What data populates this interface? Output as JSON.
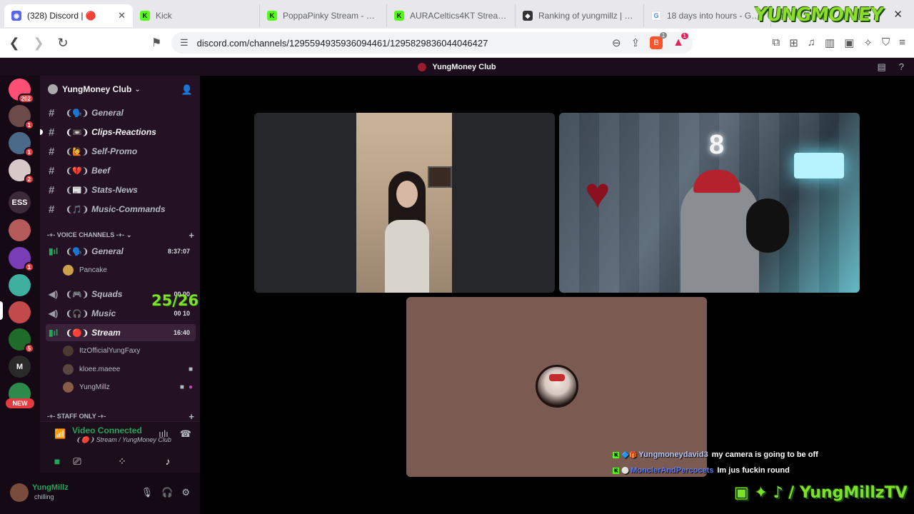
{
  "browser": {
    "tabs": [
      {
        "label": "(328) Discord | 🔴",
        "icon": "discord-icon",
        "active": true
      },
      {
        "label": "Kick",
        "icon": "kick-icon"
      },
      {
        "label": "PoppaPinky Stream - Watc",
        "icon": "kick-icon"
      },
      {
        "label": "AURACeltics4KT Stream - V",
        "icon": "kick-icon"
      },
      {
        "label": "Ranking of yungmillz | Bot",
        "icon": "shield-icon"
      },
      {
        "label": "18 days into hours - Goog",
        "icon": "google-icon"
      }
    ],
    "new_tab": "+",
    "url": "discord.com/channels/1295594935936094461/1295829836044046427",
    "brave_shield_count": "1",
    "rewards_count": "1"
  },
  "watermark": "YUNGMONEY",
  "discord": {
    "top_title": "YungMoney Club",
    "guilds": [
      {
        "label": "",
        "badge": "202",
        "color": "#ff4f75"
      },
      {
        "label": "",
        "badge": "1",
        "color": "#6b4a4a"
      },
      {
        "label": "",
        "badge": "1",
        "color": "#4b6a8a"
      },
      {
        "label": "",
        "badge": "2",
        "color": "#d8c9c9"
      },
      {
        "label": "ESS",
        "badge": "",
        "color": "#3c2a3a"
      },
      {
        "label": "",
        "badge": "",
        "color": "#b55a5a"
      },
      {
        "label": "",
        "badge": "1",
        "color": "#7a3db8"
      },
      {
        "label": "",
        "badge": "",
        "color": "#3fb0a0"
      },
      {
        "label": "",
        "badge": "",
        "color": "#c24a4a"
      },
      {
        "label": "",
        "badge": "5",
        "color": "#1e6b2a"
      },
      {
        "label": "M",
        "badge": "",
        "color": "#2a2a2a"
      },
      {
        "label": "",
        "badge": "",
        "color": "#2e8a4a"
      },
      {
        "label": "NEW",
        "badge": "",
        "color": "#e23b40"
      }
    ],
    "server_name": "YungMoney Club",
    "text_channels": [
      {
        "name": "General",
        "emoji": "❨🗣️❩",
        "unread": false
      },
      {
        "name": "Clips-Reactions",
        "emoji": "❨📼❩",
        "unread": true
      },
      {
        "name": "Self-Promo",
        "emoji": "❨🙋❩",
        "unread": false
      },
      {
        "name": "Beef",
        "emoji": "❨💔❩",
        "unread": false
      },
      {
        "name": "Stats-News",
        "emoji": "❨📰❩",
        "unread": false
      },
      {
        "name": "Music-Commands",
        "emoji": "❨🎵❩",
        "unread": false
      }
    ],
    "voice_header": "-+- VOICE CHANNELS -+-",
    "voice_channels": {
      "general": {
        "name": "General",
        "emoji": "❨🗣️❩",
        "timer": "8:37:07"
      },
      "general_member": "Pancake",
      "squads": {
        "name": "Squads",
        "emoji": "❨🎮❩",
        "timer": "00  00"
      },
      "music": {
        "name": "Music",
        "emoji": "❨🎧❩",
        "timer": "00  10"
      },
      "stream": {
        "name": "Stream",
        "emoji": "❨🔴❩",
        "timer": "16:40"
      },
      "stream_members": [
        "ItzOfficialYungFaxy",
        "kloee.maeee",
        "YungMillz"
      ]
    },
    "staff_header": "-+- STAFF ONLY -+-",
    "overlay_count": "25/26",
    "voice_panel": {
      "status": "Video Connected",
      "sub": "❨🔴❩ Stream / YungMoney Club"
    },
    "user": {
      "name": "YungMillz",
      "status": "chilling"
    }
  },
  "chat": [
    {
      "user": "Yungmoneydavid3",
      "message": "my camera is going to be off"
    },
    {
      "user": "MonclerAndPercocets",
      "message": "Im jus fuckin round"
    }
  ],
  "socials_text": "/ YungMillzTV"
}
